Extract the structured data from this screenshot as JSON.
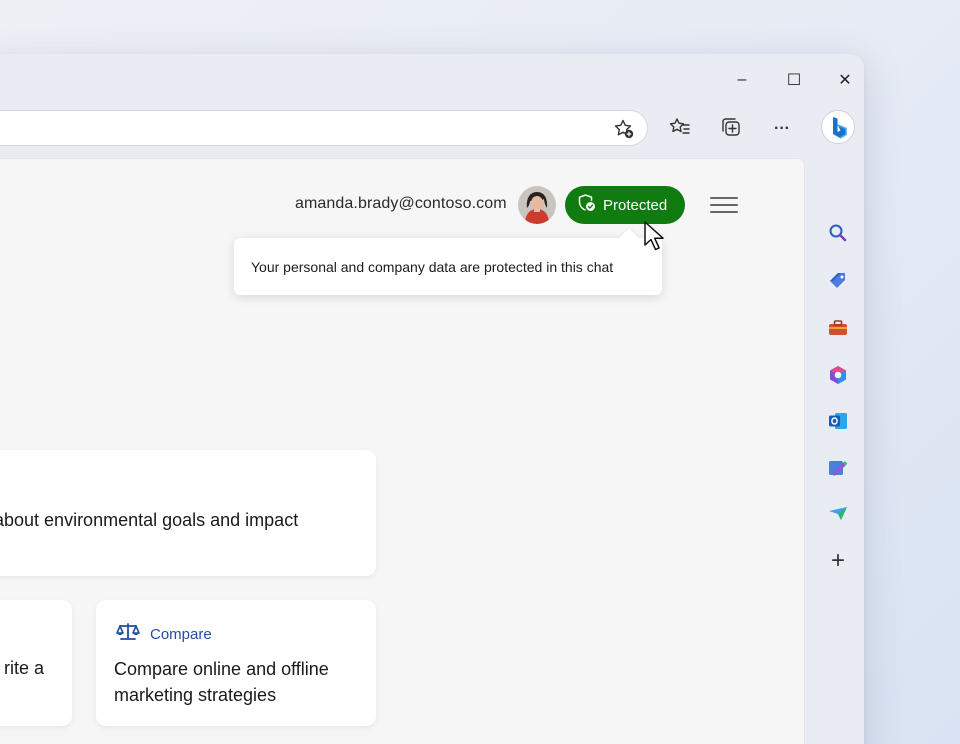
{
  "window": {
    "minimize_glyph": "–",
    "maximize_glyph": "☐",
    "close_glyph": "✕"
  },
  "toolbar": {
    "icons": [
      "add-favorite-icon",
      "favorites-icon",
      "collections-icon",
      "more-icon",
      "bing-copilot-icon"
    ],
    "more_glyph": "···"
  },
  "sidebar": {
    "icons": [
      "search-icon",
      "shopping-tag-icon",
      "tools-icon",
      "microsoft-365-icon",
      "outlook-icon",
      "drop-icon",
      "send-icon",
      "add-icon"
    ],
    "add_glyph": "+"
  },
  "header": {
    "email": "amanda.brady@contoso.com",
    "protected_label": "Protected"
  },
  "tooltip": {
    "text": "Your personal and company data are protected in this chat"
  },
  "cards": {
    "card_a_text": "s about environmental goals and impact",
    "card_b_text": "rite a",
    "card_c_category": "Compare",
    "card_c_text": "Compare online and offline marketing strategies"
  },
  "colors": {
    "protected_green": "#107c10",
    "compare_blue": "#1f4fa5"
  }
}
